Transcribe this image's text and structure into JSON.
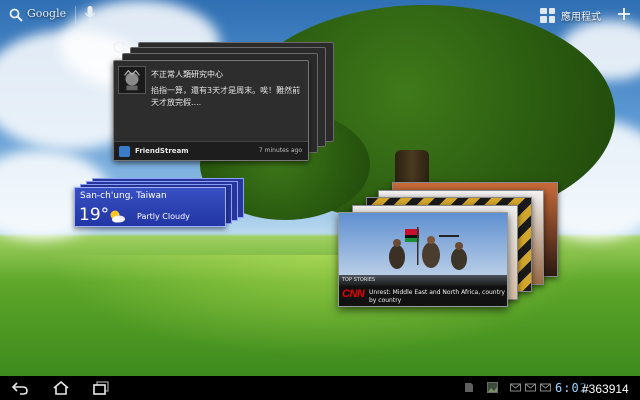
{
  "top_bar": {
    "search_icon": "search-icon",
    "google_label": "Google",
    "mic_icon": "mic-icon",
    "apps_icon": "grid-icon",
    "apps_label": "應用程式",
    "add_icon": "add-icon"
  },
  "friendstream": {
    "poster": "不正常人類研究中心",
    "message": "掐指一算，還有3天才是周末。唉！難然前天才放完假....",
    "app_name": "FriendStream",
    "time_ago": "7 minutes ago"
  },
  "weather": {
    "city": "San-ch'ung, Taiwan",
    "temperature": "19°",
    "condition": "Partly Cloudy",
    "icon": "partly-cloudy-icon"
  },
  "news": {
    "section": "TOP STORIES",
    "source": "CNN",
    "headline": "Unrest: Middle East and North Africa, country by country"
  },
  "nav_bar": {
    "back_icon": "back-icon",
    "home_icon": "home-icon",
    "recent_apps_icon": "recent-apps-icon",
    "status_icons": [
      "sd-card-icon",
      "gallery-icon",
      "mail-icon",
      "mail-icon",
      "mail-icon"
    ],
    "clock": "6:02",
    "watermark": "#363914"
  },
  "colors": {
    "weather_blue": "#2236a4",
    "clock_blue": "#9bd5ff",
    "cnn_red": "#e60000"
  }
}
